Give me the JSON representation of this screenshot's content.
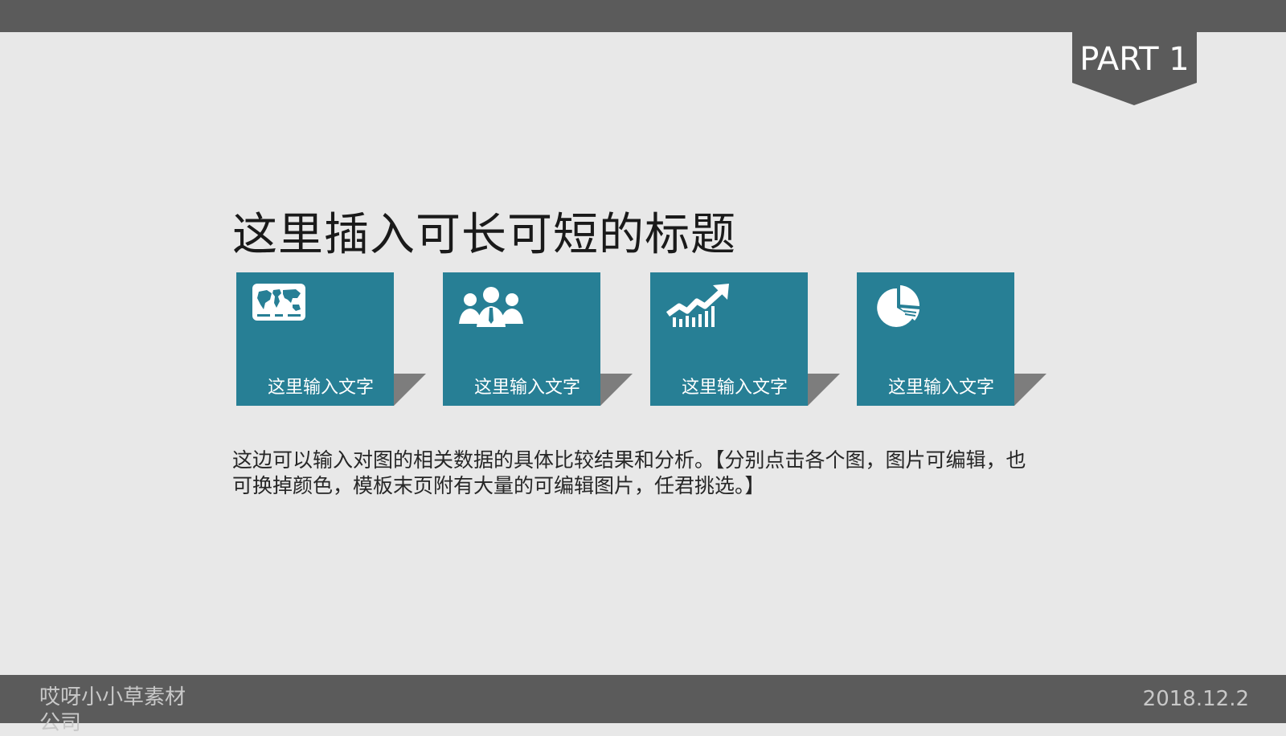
{
  "slide": {
    "part_label": "PART 1",
    "title": "这里插入可长可短的标题",
    "body_text": "这边可以输入对图的相关数据的具体比较结果和分析。【分别点击各个图，图片可编辑，也可换掉颜色，模板末页附有大量的可编辑图片，任君挑选。】"
  },
  "cards": [
    {
      "icon": "world-map-icon",
      "label": "这里输入文字"
    },
    {
      "icon": "team-people-icon",
      "label": "这里输入文字"
    },
    {
      "icon": "growth-chart-icon",
      "label": "这里输入文字"
    },
    {
      "icon": "pie-chart-icon",
      "label": "这里输入文字"
    }
  ],
  "footer": {
    "company": "哎呀小小草素材公司",
    "date": "2018.12.2"
  },
  "colors": {
    "card": "#277f95",
    "bars": "#5b5b5b",
    "background": "#e8e8e8",
    "fold": "#7d7d7d"
  }
}
